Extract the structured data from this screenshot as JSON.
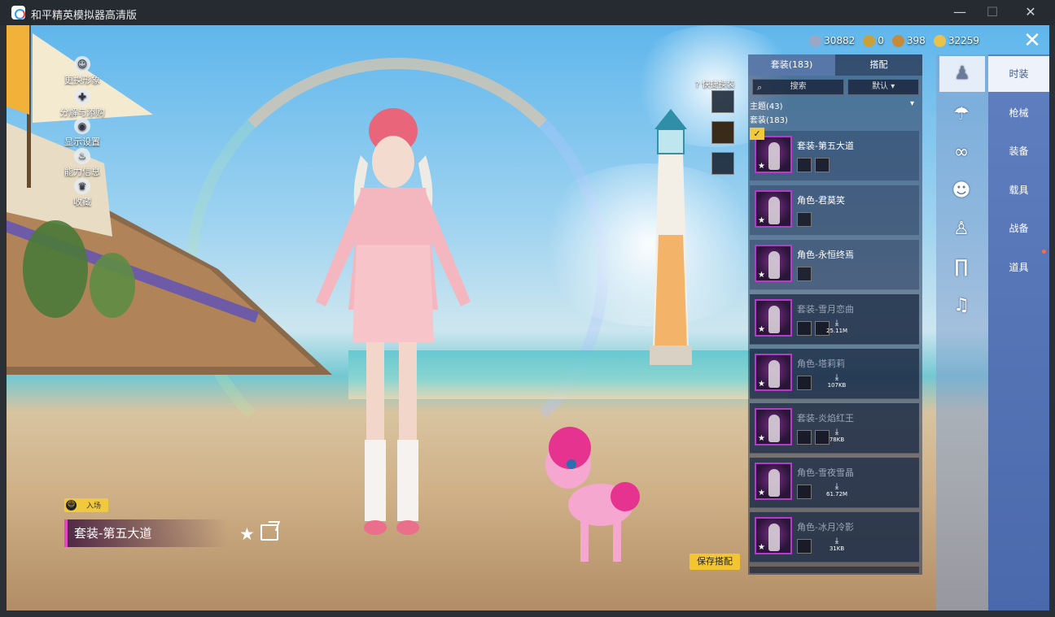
{
  "window": {
    "title": "和平精英模拟器高清版",
    "minimize": "—",
    "maximize": "☐",
    "close": "✕"
  },
  "resources": [
    {
      "icon": "silver-coin-icon",
      "value": "30882",
      "color": "#9aa7c7"
    },
    {
      "icon": "gold-medal-icon",
      "value": "0",
      "color": "#c9a13b"
    },
    {
      "icon": "bronze-coin-icon",
      "value": "398",
      "color": "#c78a3b"
    },
    {
      "icon": "gold-coin-icon",
      "value": "32259",
      "color": "#e8c24a"
    }
  ],
  "side_menu": [
    {
      "label": "更换形象",
      "icon": "person-icon",
      "glyph": "☺"
    },
    {
      "label": "分解与添购",
      "icon": "decompose-icon",
      "glyph": "✚"
    },
    {
      "label": "显示设置",
      "icon": "eye-icon",
      "glyph": "◉"
    },
    {
      "label": "能力信息",
      "icon": "fire-icon",
      "glyph": "♨"
    },
    {
      "label": "收藏",
      "icon": "crown-icon",
      "glyph": "♛"
    }
  ],
  "quick_change": {
    "label": "快捷换装"
  },
  "entry": {
    "label": "入场"
  },
  "outfit": {
    "name": "套装-第五大道"
  },
  "panel": {
    "tabs": [
      {
        "label": "套装(183)",
        "active": true
      },
      {
        "label": "搭配",
        "active": false
      }
    ],
    "search_label": "搜索",
    "sort_label": "默认",
    "theme": "主题(43)",
    "suit_count": "套装(183)",
    "items": [
      {
        "name": "套装-第五大道",
        "dimmed": false,
        "minis": 2,
        "size": ""
      },
      {
        "name": "角色-君莫笑",
        "dimmed": false,
        "minis": 1,
        "size": ""
      },
      {
        "name": "角色-永恒终焉",
        "dimmed": false,
        "minis": 1,
        "size": ""
      },
      {
        "name": "套装-雪月恋曲",
        "dimmed": true,
        "minis": 2,
        "size": "25.11M"
      },
      {
        "name": "角色-塔莉莉",
        "dimmed": true,
        "minis": 1,
        "size": "107KB"
      },
      {
        "name": "套装-炎焰红王",
        "dimmed": true,
        "minis": 2,
        "size": "78KB"
      },
      {
        "name": "角色-雪夜雪晶",
        "dimmed": true,
        "minis": 1,
        "size": "61.72M"
      },
      {
        "name": "角色-冰月冷影",
        "dimmed": true,
        "minis": 1,
        "size": "31KB"
      }
    ]
  },
  "save_button": "保存搭配",
  "categories": [
    {
      "icon": "outfit-icon",
      "glyph": "♟",
      "active": true
    },
    {
      "icon": "hat-icon",
      "glyph": "☂",
      "active": false
    },
    {
      "icon": "glasses-icon",
      "glyph": "∞",
      "active": false
    },
    {
      "icon": "mask-icon",
      "glyph": "☻",
      "active": false
    },
    {
      "icon": "top-icon",
      "glyph": "♙",
      "active": false
    },
    {
      "icon": "pants-icon",
      "glyph": "∏",
      "active": false
    },
    {
      "icon": "shoes-icon",
      "glyph": "♫",
      "active": false
    }
  ],
  "menu": [
    {
      "label": "时装",
      "active": true
    },
    {
      "label": "枪械",
      "active": false
    },
    {
      "label": "装备",
      "active": false
    },
    {
      "label": "载具",
      "active": false
    },
    {
      "label": "战备",
      "active": false
    },
    {
      "label": "道具",
      "active": false
    }
  ]
}
